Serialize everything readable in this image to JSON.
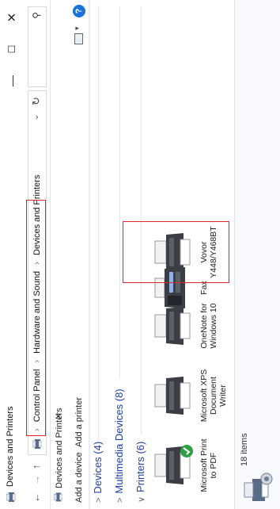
{
  "window": {
    "title": "Devices and Printers",
    "controls": {
      "minimize": "—",
      "maximize": "☐",
      "close": "✕"
    }
  },
  "nav": {
    "back": "←",
    "forward": "→",
    "up": "↑"
  },
  "address": {
    "crumbs": [
      "Control Panel",
      "Hardware and Sound",
      "Devices and Printers"
    ],
    "separator": "›",
    "dropdown": "⌄",
    "refresh": "↻"
  },
  "search": {
    "icon": "⚲"
  },
  "tab": {
    "label": "Devices and Printers",
    "close": "✕"
  },
  "commands": {
    "add_device": "Add a device",
    "add_printer": "Add a printer",
    "view_dropdown": "▾",
    "help": "?"
  },
  "sections": {
    "devices": {
      "chevron": ">",
      "label": "Devices (4)"
    },
    "multimedia": {
      "chevron": ">",
      "label": "Multimedia Devices (8)"
    },
    "printers": {
      "chevron": "∨",
      "label": "Printers (6)"
    }
  },
  "printers": [
    {
      "label": "Microsoft Print to PDF",
      "icon": "printer-icon",
      "default": true
    },
    {
      "label": "Microsoft XPS Document Writer",
      "icon": "printer-icon"
    },
    {
      "label": "OneNote for Windows 10",
      "icon": "printer-icon"
    },
    {
      "label": "Fax",
      "icon": "fax-icon"
    },
    {
      "label": "Vovor Y448/Y468BT",
      "icon": "printer-icon"
    }
  ],
  "status": {
    "item_count": "18 items"
  },
  "colors": {
    "annotation": "#e0262c",
    "section_link": "#1e3f9e",
    "default_badge": "#2ea043",
    "help": "#1a73d9"
  }
}
